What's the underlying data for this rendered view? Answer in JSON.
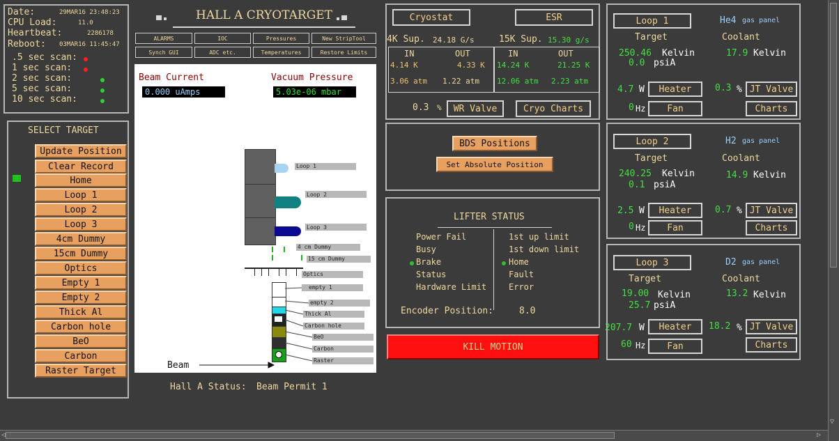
{
  "status": {
    "date_label": "Date:",
    "date_value": "29MAR16 23:48:23",
    "cpu_label": "CPU Load:",
    "cpu_value": "11.0",
    "heartbeat_label": "Heartbeat:",
    "heartbeat_value": "2286178",
    "reboot_label": "Reboot:",
    "reboot_value": "03MAR16 11:45:47",
    "scans": [
      {
        "label": ".5 sec scan:",
        "color": "#ff2020"
      },
      {
        "label": " 1 sec scan:",
        "color": "#ff2020"
      },
      {
        "label": " 2 sec scan:",
        "color": "#30d030"
      },
      {
        "label": " 5 sec scan:",
        "color": "#30d030"
      },
      {
        "label": "10 sec scan:",
        "color": "#30d030"
      }
    ]
  },
  "select_target": {
    "title": "SELECT TARGET",
    "items": [
      "Update Position",
      "Clear Record",
      "Home",
      "Loop 1",
      "Loop 2",
      "Loop 3",
      "4cm Dummy",
      "15cm Dummy",
      "Optics",
      "Empty 1",
      "Empty 2",
      "Thick Al",
      "Carbon hole",
      "BeO",
      "Carbon",
      "Raster Target"
    ]
  },
  "header": {
    "title": "HALL A CRYOTARGET",
    "buttons": [
      "ALARMS",
      "IOC",
      "Pressures",
      "New StripTool",
      "Synch GUI",
      "ADC etc.",
      "Temperatures",
      "Restore Limits"
    ]
  },
  "beam": {
    "current_label": "Beam Current",
    "current_value": "0.000 uAmps",
    "vacuum_label": "Vacuum Pressure",
    "vacuum_value": "5.03e-06 mbar",
    "beam_label": "Beam",
    "targets": [
      "Loop 1",
      "Loop 2",
      "Loop 3",
      "4 cm Dummy",
      "15 cm Dummy",
      "Optics",
      "empty 1",
      "empty 2",
      "Thick Al",
      "Carbon hole",
      "BeO",
      "Carbon",
      "Raster"
    ],
    "hall_status_label": "Hall A Status:",
    "hall_status_value": "Beam Permit 1"
  },
  "cryostat": {
    "cryostat_btn": "Cryostat",
    "esr_btn": "ESR",
    "sup4k_label": "4K Sup.",
    "sup4k_value": "24.18 G/s",
    "sup15k_label": "15K Sup.",
    "sup15k_value": "15.30 g/s",
    "in_label": "IN",
    "out_label": "OUT",
    "k4_in_temp": "4.14 K",
    "k4_out_temp": "4.33 K",
    "k4_in_p": "3.06 atm",
    "k4_out_p": "1.22 atm",
    "k15_in_temp": "14.24 K",
    "k15_out_temp": "21.25 K",
    "k15_in_p": "12.06 atm",
    "k15_out_p": "2.23 atm",
    "wr_value": "0.3",
    "wr_unit": "%",
    "wr_btn": "WR Valve",
    "charts_btn": "Cryo Charts"
  },
  "bds": {
    "positions_btn": "BDS Positions",
    "abs_btn": "Set Absolute Position"
  },
  "lifter": {
    "title": "LIFTER STATUS",
    "left": [
      "Power Fail",
      "Busy",
      "Brake",
      "Status",
      "Hardware Limit"
    ],
    "right": [
      "1st up limit",
      "1st down limit",
      "Home",
      "Fault",
      "Error"
    ],
    "encoder_label": "Encoder Position:",
    "encoder_value": "8.0"
  },
  "kill": {
    "label": "KILL MOTION"
  },
  "loops": [
    {
      "name": "Loop 1",
      "gas": "He4",
      "gas_suffix": "gas panel",
      "target_label": "Target",
      "coolant_label": "Coolant",
      "target_temp": "250.46",
      "temp_unit": "Kelvin",
      "target_p": "0.0",
      "p_unit": "psiA",
      "coolant_temp": "17.9",
      "heater_val": "4.7",
      "heater_unit": "W",
      "heater_btn": "Heater",
      "jt_val": "0.3",
      "jt_unit": "%",
      "jt_btn": "JT Valve",
      "fan_val": "0",
      "fan_unit": "Hz",
      "fan_btn": "Fan",
      "charts_btn": "Charts"
    },
    {
      "name": "Loop 2",
      "gas": "H2",
      "gas_suffix": "gas panel",
      "target_label": "Target",
      "coolant_label": "Coolant",
      "target_temp": "240.25",
      "temp_unit": "Kelvin",
      "target_p": "0.1",
      "p_unit": "psiA",
      "coolant_temp": "14.9",
      "heater_val": "2.5",
      "heater_unit": "W",
      "heater_btn": "Heater",
      "jt_val": "0.7",
      "jt_unit": "%",
      "jt_btn": "JT Valve",
      "fan_val": "0",
      "fan_unit": "Hz",
      "fan_btn": "Fan",
      "charts_btn": "Charts"
    },
    {
      "name": "Loop 3",
      "gas": "D2",
      "gas_suffix": "gas panel",
      "target_label": "Target",
      "coolant_label": "Coolant",
      "target_temp": "19.00",
      "temp_unit": "Kelvin",
      "target_p": "25.7",
      "p_unit": "psiA",
      "coolant_temp": "13.2",
      "heater_val": "207.7",
      "heater_unit": "W",
      "heater_btn": "Heater",
      "jt_val": "18.2",
      "jt_unit": "%",
      "jt_btn": "JT Valve",
      "fan_val": "60",
      "fan_unit": "Hz",
      "fan_btn": "Fan",
      "charts_btn": "Charts"
    }
  ]
}
